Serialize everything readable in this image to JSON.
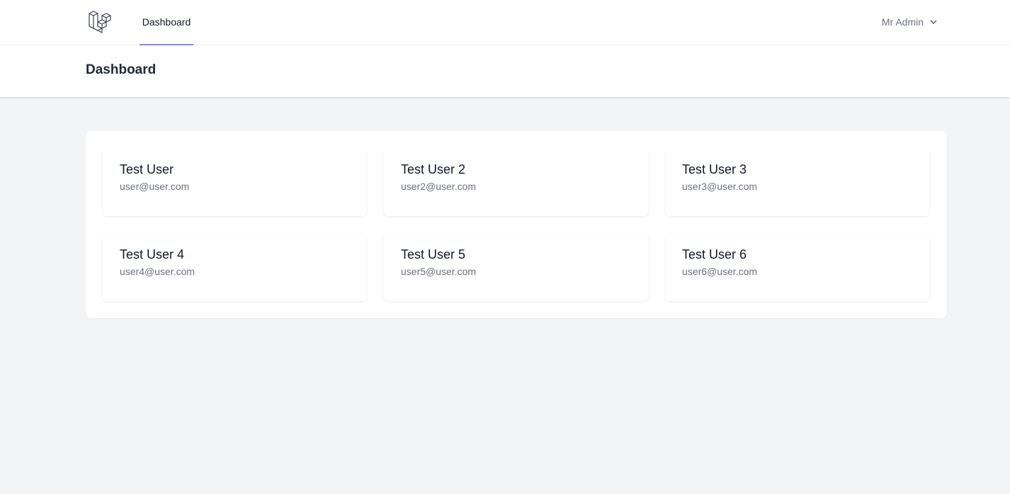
{
  "nav": {
    "links": [
      {
        "label": "Dashboard",
        "active": true
      }
    ],
    "user_menu": {
      "name": "Mr Admin"
    },
    "active_color": "#818cf8"
  },
  "header": {
    "title": "Dashboard"
  },
  "users": [
    {
      "name": "Test User",
      "email": "user@user.com"
    },
    {
      "name": "Test User 2",
      "email": "user2@user.com"
    },
    {
      "name": "Test User 3",
      "email": "user3@user.com"
    },
    {
      "name": "Test User 4",
      "email": "user4@user.com"
    },
    {
      "name": "Test User 5",
      "email": "user5@user.com"
    },
    {
      "name": "Test User 6",
      "email": "user6@user.com"
    }
  ]
}
